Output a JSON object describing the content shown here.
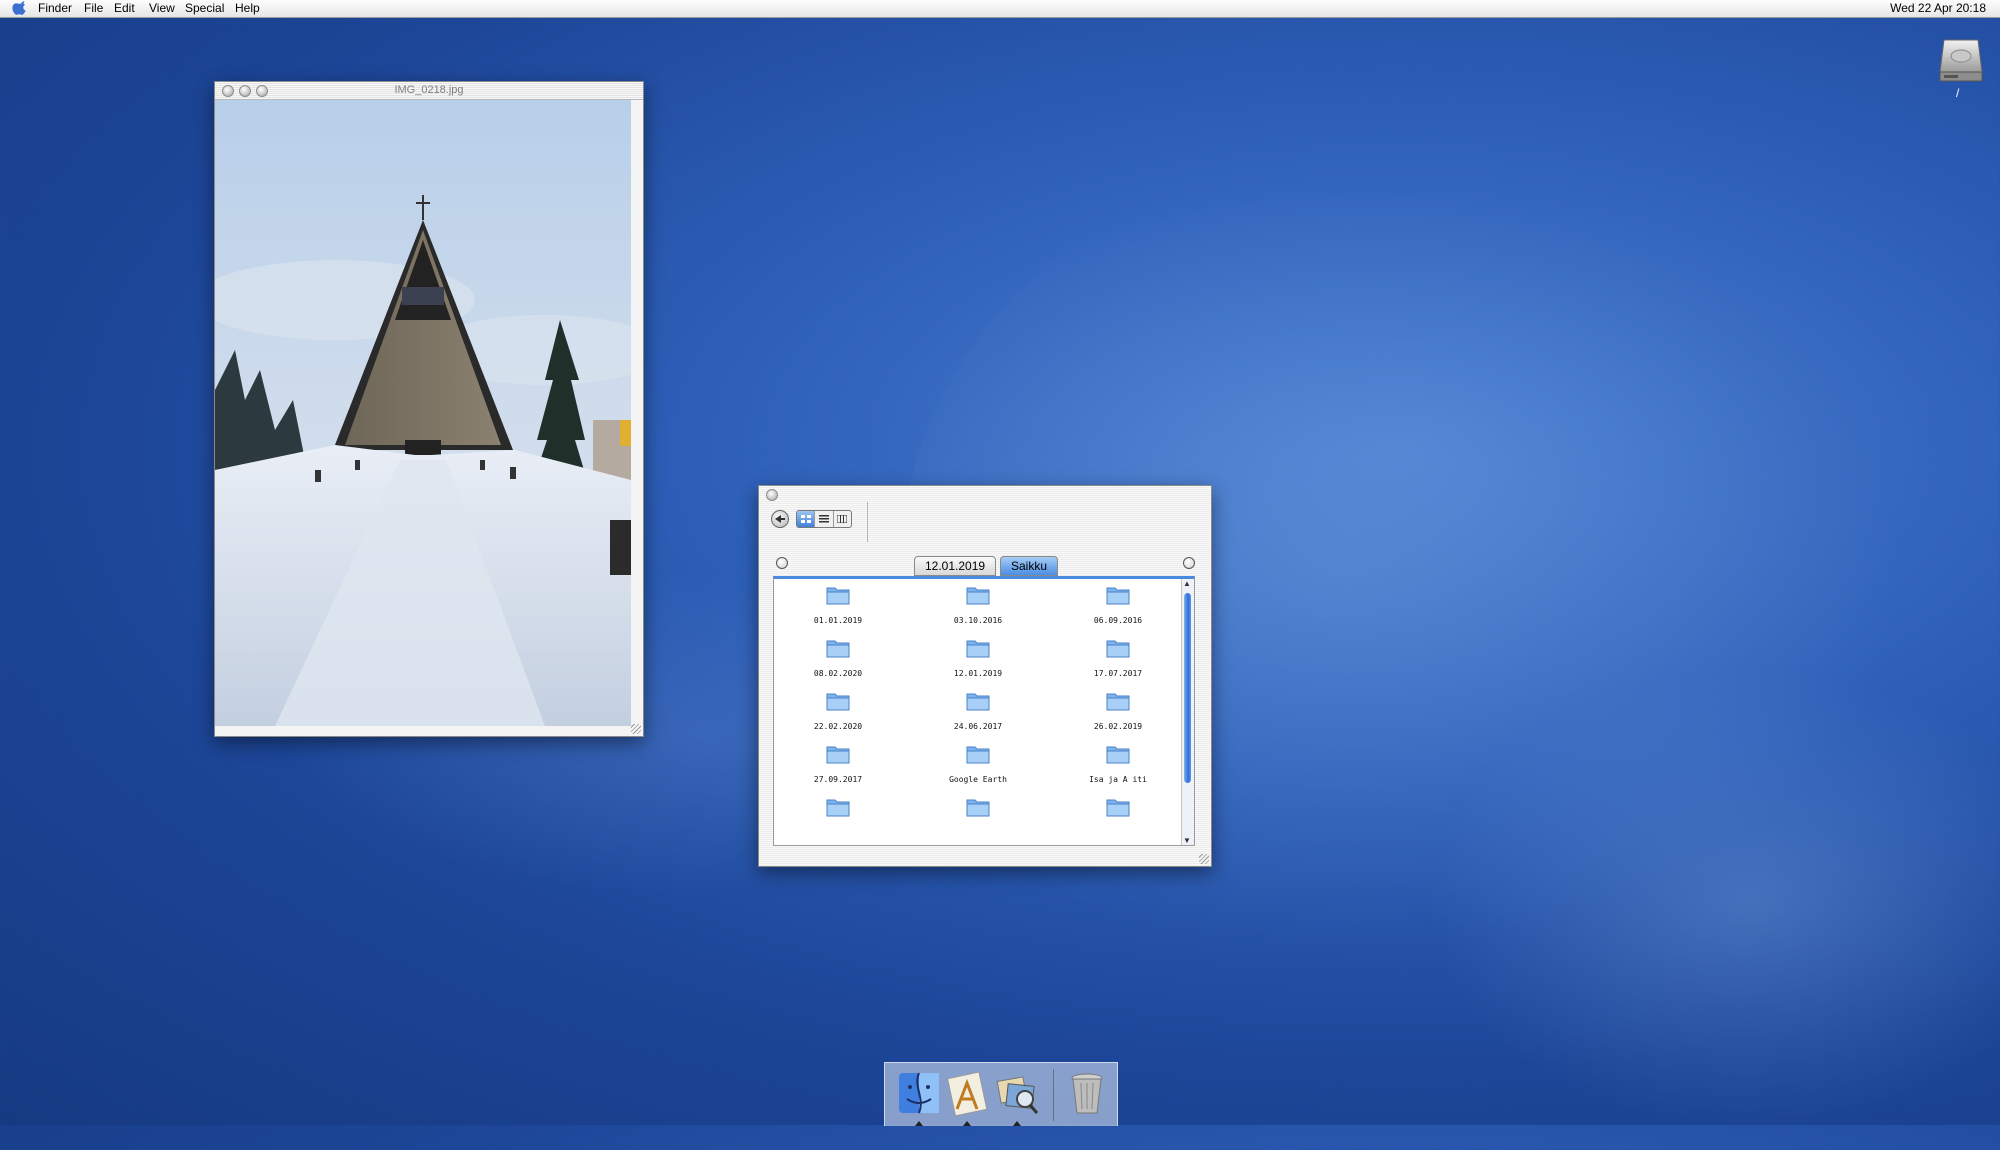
{
  "menubar": {
    "apple_icon": "apple-icon",
    "items": [
      "Finder",
      "File",
      "Edit",
      "View",
      "Special",
      "Help"
    ],
    "clock": "Wed 22 Apr 20:18"
  },
  "desktop": {
    "hd_icon": "hard-drive-icon",
    "hd_label": "/"
  },
  "image_window": {
    "title": "IMG_0218.jpg"
  },
  "finder_window": {
    "path_tabs": [
      "12.01.2019",
      "Saikku"
    ],
    "active_tab": "Saikku",
    "folders": [
      "01.01.2019",
      "03.10.2016",
      "06.09.2016",
      "08.02.2020",
      "12.01.2019",
      "17.07.2017",
      "22.02.2020",
      "24.06.2017",
      "26.02.2019",
      "27.09.2017",
      "Google Earth",
      "Isa   ja A  iti",
      "",
      "",
      ""
    ]
  },
  "dock": {
    "items": [
      "finder-icon",
      "text-edit-icon",
      "preview-icon",
      "trash-icon"
    ]
  },
  "colors": {
    "accent": "#3f7fd8",
    "desktop": "#1d4698"
  }
}
